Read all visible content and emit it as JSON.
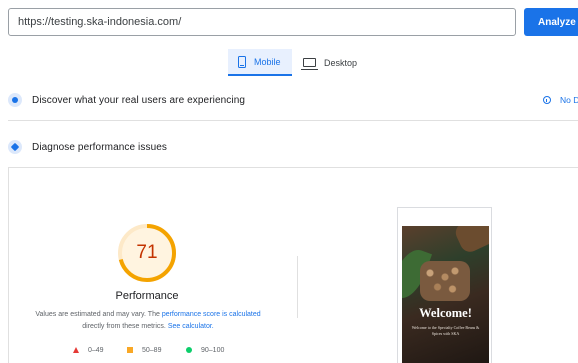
{
  "search": {
    "url_value": "https://testing.ska-indonesia.com/",
    "analyze_label": "Analyze"
  },
  "tabs": [
    {
      "label": "Mobile",
      "icon": "phone-icon",
      "selected": true
    },
    {
      "label": "Desktop",
      "icon": "desktop-icon",
      "selected": false
    }
  ],
  "sections": {
    "users_label": "Discover what your real users are experiencing",
    "no_data_label": "No Da",
    "diagnose_label": "Diagnose performance issues"
  },
  "performance": {
    "score": "71",
    "score_fraction": 0.71,
    "title": "Performance",
    "note_prefix": "Values are estimated and may vary. The ",
    "note_link": "performance score is calculated",
    "note_middle": " directly from these metrics. ",
    "note_link2": "See calculator.",
    "legend": [
      {
        "range": "0–49",
        "shape": "triangle",
        "color": "#e53935"
      },
      {
        "range": "50–89",
        "shape": "square",
        "color": "#f9a825"
      },
      {
        "range": "90–100",
        "shape": "circle",
        "color": "#0cce6b"
      }
    ]
  },
  "screenshot": {
    "welcome": "Welcome!",
    "subtitle": "Welcome to the Specialty Coffee Beans & Spices with SKA"
  },
  "colors": {
    "accent": "#1a73e8",
    "score_average": "#f4a300"
  }
}
